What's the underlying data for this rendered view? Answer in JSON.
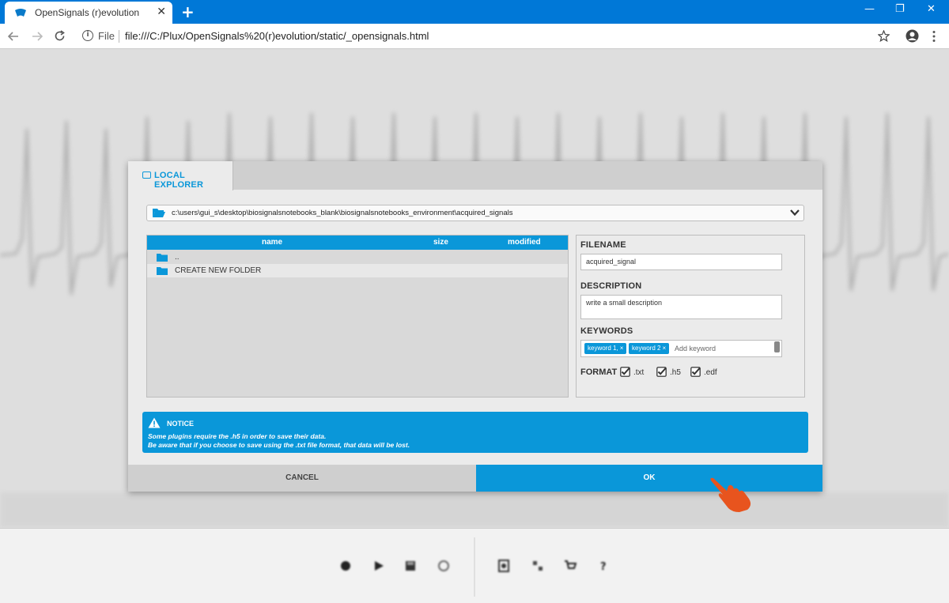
{
  "browser": {
    "tab_title": "OpenSignals (r)evolution",
    "tab_close": "✕",
    "new_tab": "+",
    "file_label": "File",
    "url": "file:///C:/Plux/OpenSignals%20(r)evolution/static/_opensignals.html",
    "window_controls": [
      "—",
      "❐",
      "✕"
    ]
  },
  "dialog": {
    "tab_label": "LOCAL EXPLORER",
    "path": "c:\\users\\gui_s\\desktop\\biosignalsnotebooks_blank\\biosignalsnotebooks_environment\\acquired_signals",
    "file_list": {
      "columns": {
        "name": "name",
        "size": "size",
        "modified": "modified"
      },
      "rows": [
        {
          "label": ".."
        },
        {
          "label": "CREATE NEW FOLDER"
        }
      ]
    },
    "meta": {
      "filename_label": "FILENAME",
      "filename_value": "acquired_signal",
      "description_label": "DESCRIPTION",
      "description_value": "write a small description",
      "keywords_label": "KEYWORDS",
      "keywords": [
        "keyword 1,",
        "keyword 2"
      ],
      "keyword_placeholder": "Add keyword",
      "format_label": "FORMAT",
      "formats": [
        ".txt",
        ".h5",
        ".edf"
      ]
    },
    "notice": {
      "title": "NOTICE",
      "line1": "Some plugins require the .h5 in order to save their data.",
      "line2": "Be aware that if you choose to save using the .txt file format, that data will be lost."
    },
    "cancel_label": "CANCEL",
    "ok_label": "OK"
  },
  "colors": {
    "accent": "#0a97d9",
    "chrome": "#0078d7",
    "pointer": "#e8541e"
  },
  "icons": {
    "pointer": "hand-pointer-icon"
  }
}
